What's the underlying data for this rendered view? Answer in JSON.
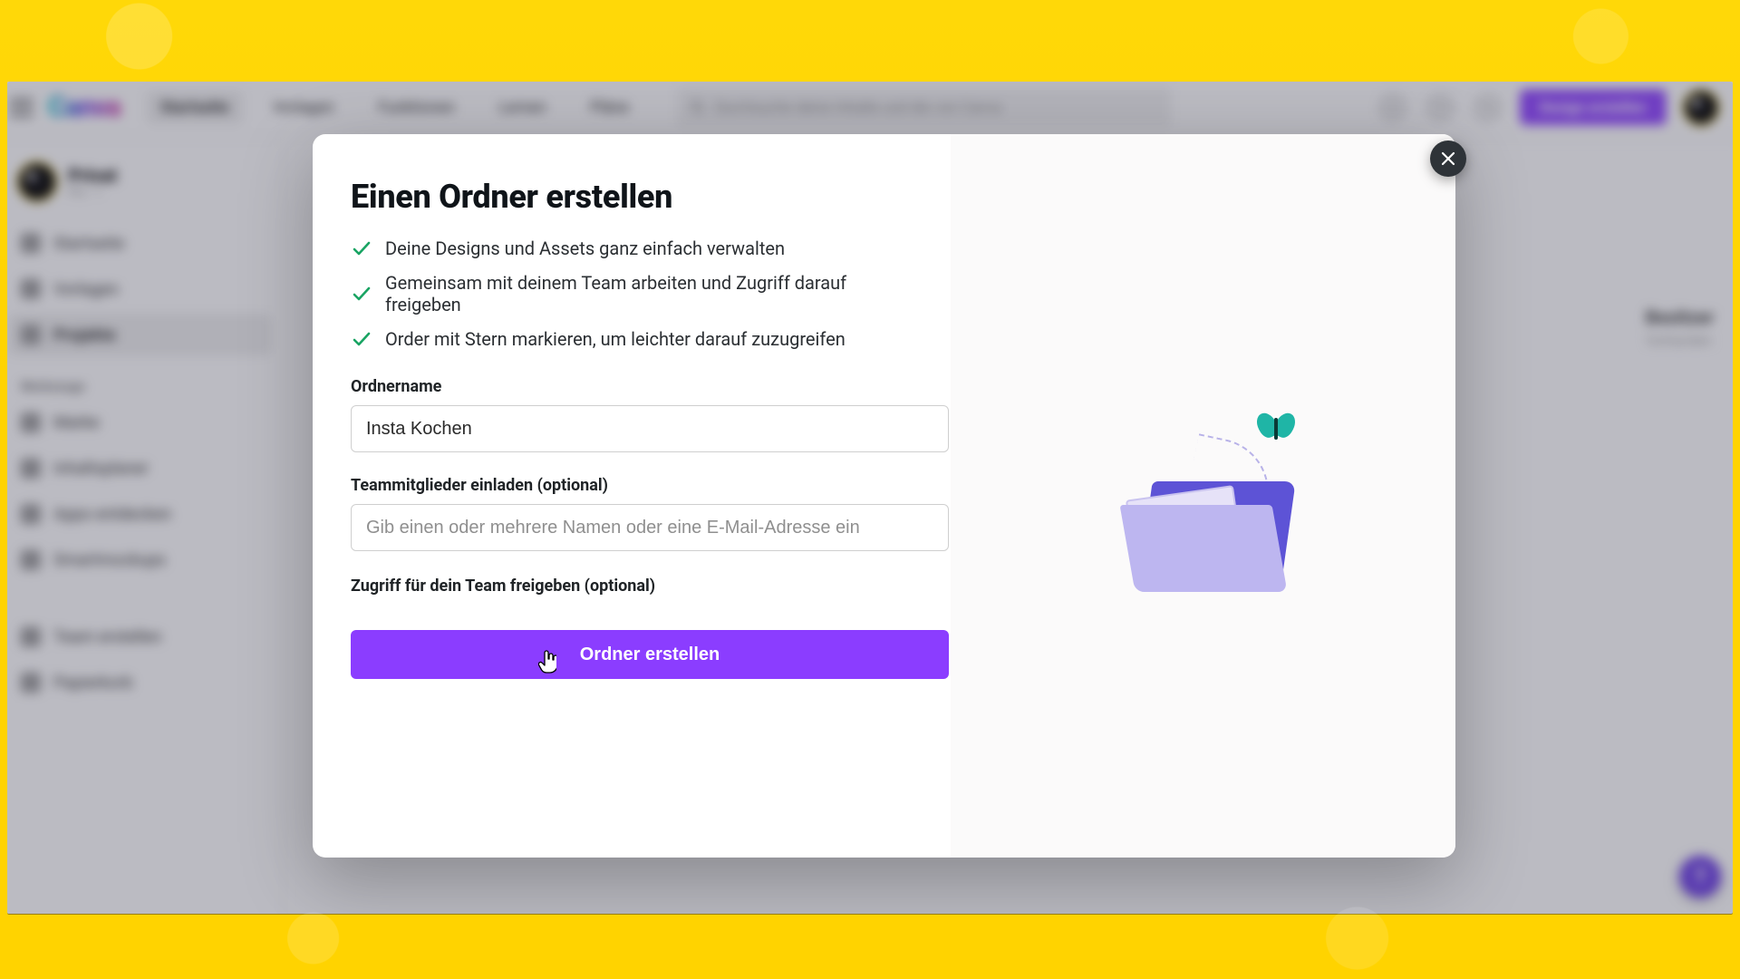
{
  "topbar": {
    "logo_text": "Canva",
    "nav": {
      "home": "Startseite",
      "templates": "Vorlagen",
      "features": "Funktionen",
      "learn": "Lernen",
      "plans": "Pläne"
    },
    "search_placeholder": "Durchsuche deine Inhalte und die von Canva",
    "cta_label": "Design erstellen"
  },
  "sidebar": {
    "user_name": "Privat",
    "user_sub": "Pro · 1",
    "items": {
      "home": "Startseite",
      "templates": "Vorlagen",
      "projects": "Projekte"
    },
    "tools_heading": "Werkzeuge",
    "tools": {
      "brand": "Marke",
      "content_planner": "Inhaltsplaner",
      "discover_apps": "Apps entdecken",
      "smartmockups": "Smartmockups"
    },
    "team_create": "Team erstellen",
    "trash": "Papierkorb"
  },
  "page": {
    "column_header": "Besitzer",
    "column_value": "Vorhanden"
  },
  "modal": {
    "title": "Einen Ordner erstellen",
    "benefits": {
      "b1": "Deine Designs und Assets ganz einfach verwalten",
      "b2": "Gemeinsam mit deinem Team arbeiten und Zugriff darauf freigeben",
      "b3": "Order mit Stern markieren, um leichter darauf zuzugreifen"
    },
    "folder_name_label": "Ordnername",
    "folder_name_value": "Insta Kochen",
    "invite_label": "Teammitglieder einladen (optional)",
    "invite_placeholder": "Gib einen oder mehrere Namen oder eine E-Mail-Adresse ein",
    "share_label": "Zugriff für dein Team freigeben (optional)",
    "create_button": "Ordner erstellen",
    "close_aria": "Schließen"
  },
  "help_fab": "?"
}
